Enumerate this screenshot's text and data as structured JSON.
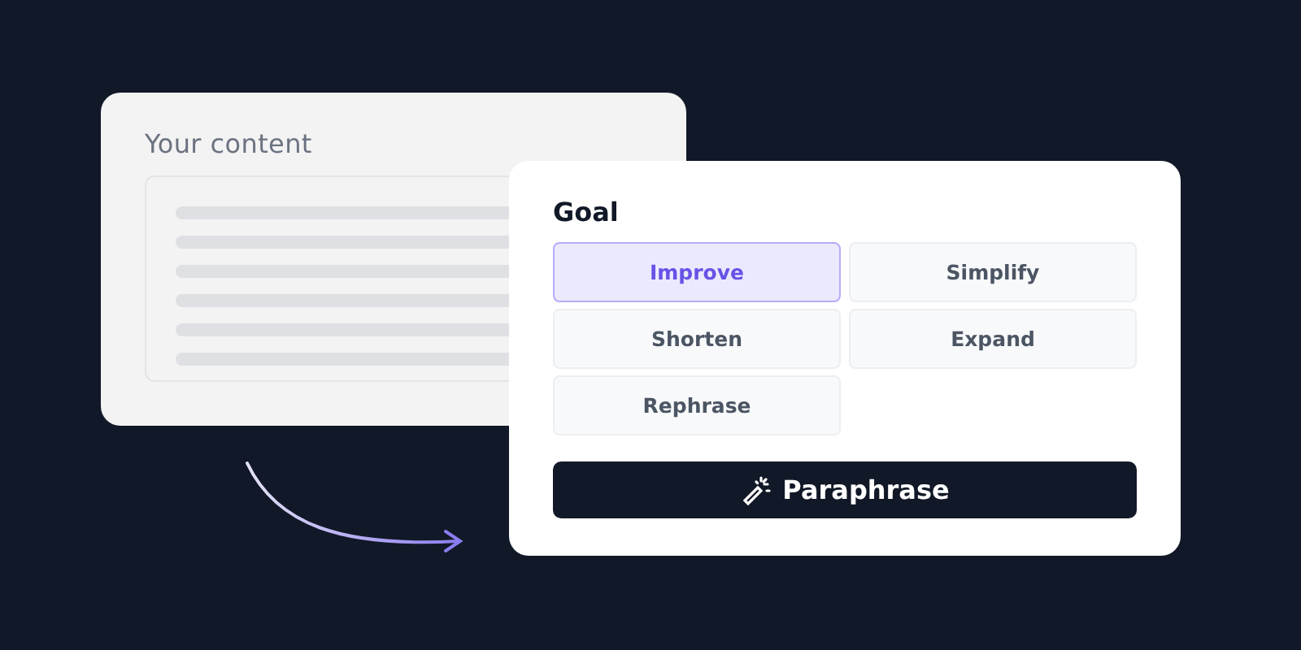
{
  "content_panel": {
    "title": "Your content"
  },
  "goal_panel": {
    "title": "Goal",
    "options": [
      {
        "label": "Improve",
        "selected": true
      },
      {
        "label": "Simplify",
        "selected": false
      },
      {
        "label": "Shorten",
        "selected": false
      },
      {
        "label": "Expand",
        "selected": false
      },
      {
        "label": "Rephrase",
        "selected": false
      }
    ],
    "action_button": {
      "label": "Paraphrase"
    }
  }
}
